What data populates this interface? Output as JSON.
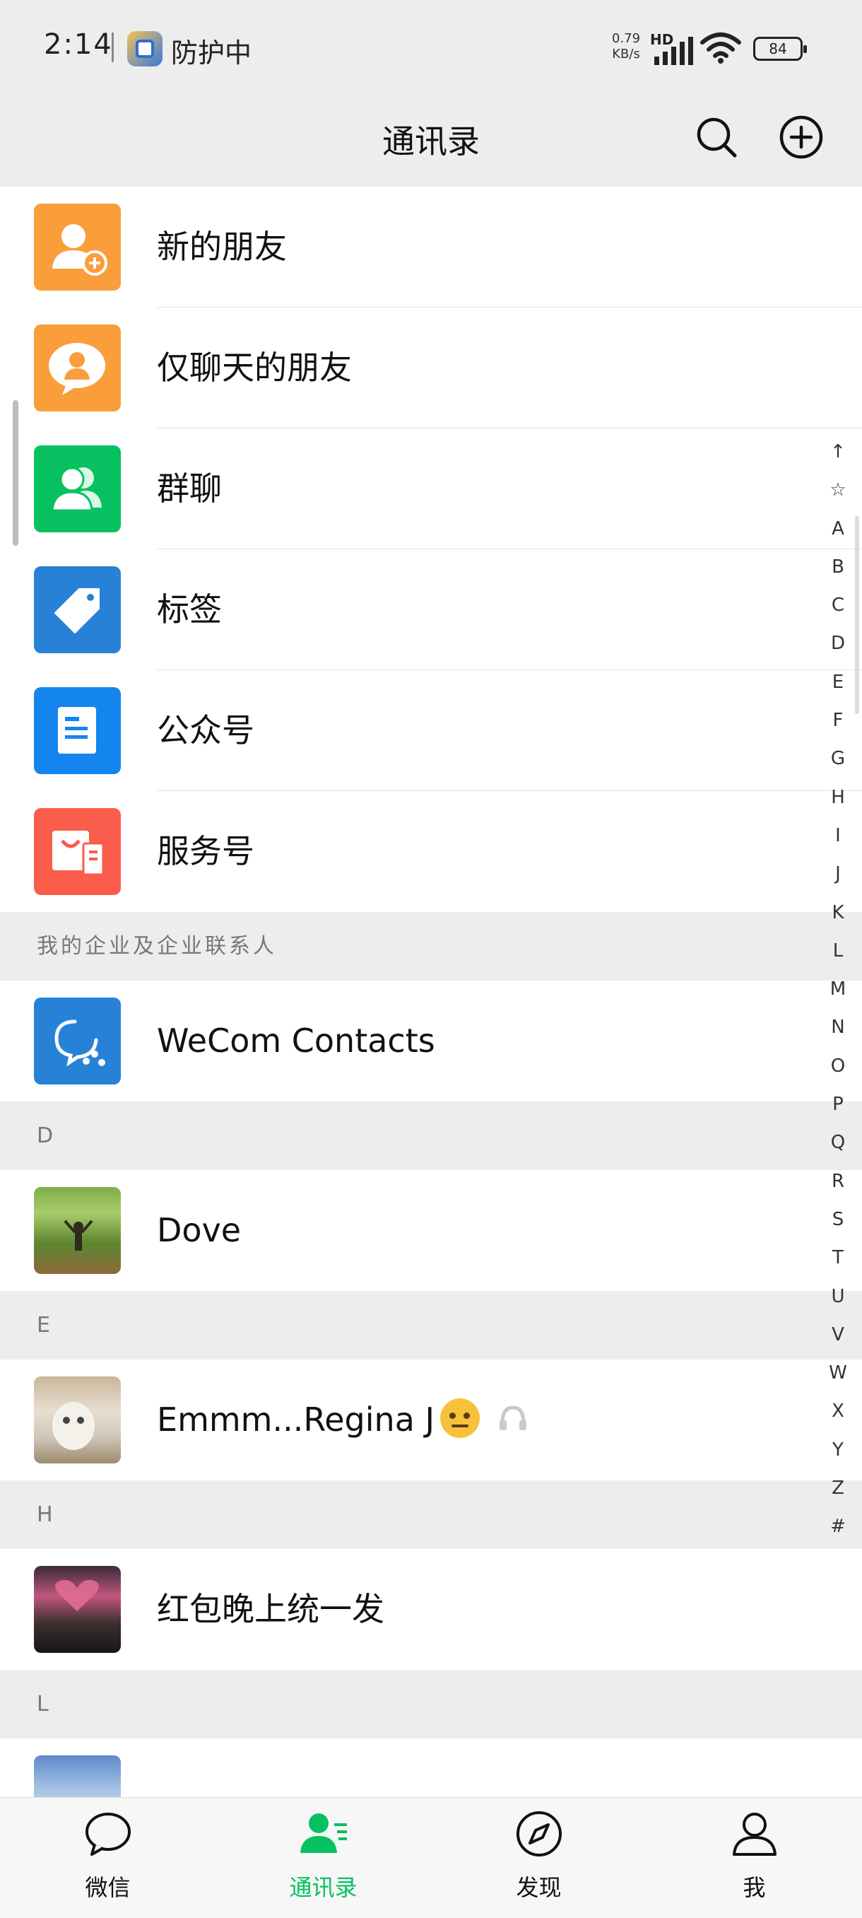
{
  "status_bar": {
    "time": "2:14",
    "protect_text": "防护中",
    "net_speed_value": "0.79",
    "net_speed_unit": "KB/s",
    "hd_label": "HD",
    "battery": "84"
  },
  "header": {
    "title": "通讯录",
    "search_icon": "search-icon",
    "add_icon": "plus-circle-icon"
  },
  "menu_items": [
    {
      "label": "新的朋友",
      "icon": "add-friend-icon",
      "color": "#fa9d3b"
    },
    {
      "label": "仅聊天的朋友",
      "icon": "chat-only-friend-icon",
      "color": "#fa9d3b"
    },
    {
      "label": "群聊",
      "icon": "group-chat-icon",
      "color": "#07c160"
    },
    {
      "label": "标签",
      "icon": "tag-icon",
      "color": "#2782d7"
    },
    {
      "label": "公众号",
      "icon": "official-account-icon",
      "color": "#1485ee"
    },
    {
      "label": "服务号",
      "icon": "service-account-icon",
      "color": "#fa5d4b"
    }
  ],
  "enterprise_section": {
    "header": "我的企业及企业联系人",
    "item_label": "WeCom Contacts",
    "item_color": "#2782d7"
  },
  "groups": [
    {
      "letter": "D",
      "contacts": [
        {
          "name": "Dove",
          "avatar": "photo-forest-person"
        }
      ]
    },
    {
      "letter": "E",
      "contacts": [
        {
          "name": "Emmm...Regina J",
          "avatar": "photo-white-cat",
          "emoji": "raised-eyebrow-emoji",
          "badge": "wecom-badge-icon"
        }
      ]
    },
    {
      "letter": "H",
      "contacts": [
        {
          "name": "红包晚上统一发",
          "avatar": "photo-heart-sunset"
        }
      ]
    },
    {
      "letter": "L",
      "contacts": [
        {
          "name": "",
          "avatar": "photo-white-animal"
        }
      ]
    }
  ],
  "index_letters": [
    "↑",
    "☆",
    "A",
    "B",
    "C",
    "D",
    "E",
    "F",
    "G",
    "H",
    "I",
    "J",
    "K",
    "L",
    "M",
    "N",
    "O",
    "P",
    "Q",
    "R",
    "S",
    "T",
    "U",
    "V",
    "W",
    "X",
    "Y",
    "Z",
    "#"
  ],
  "bottom_nav": [
    {
      "label": "微信",
      "icon": "chat-bubble-icon",
      "active": false
    },
    {
      "label": "通讯录",
      "icon": "contacts-icon",
      "active": true
    },
    {
      "label": "发现",
      "icon": "compass-icon",
      "active": false
    },
    {
      "label": "我",
      "icon": "person-icon",
      "active": false
    }
  ],
  "colors": {
    "accent_green": "#07c160",
    "background": "#ededed"
  }
}
